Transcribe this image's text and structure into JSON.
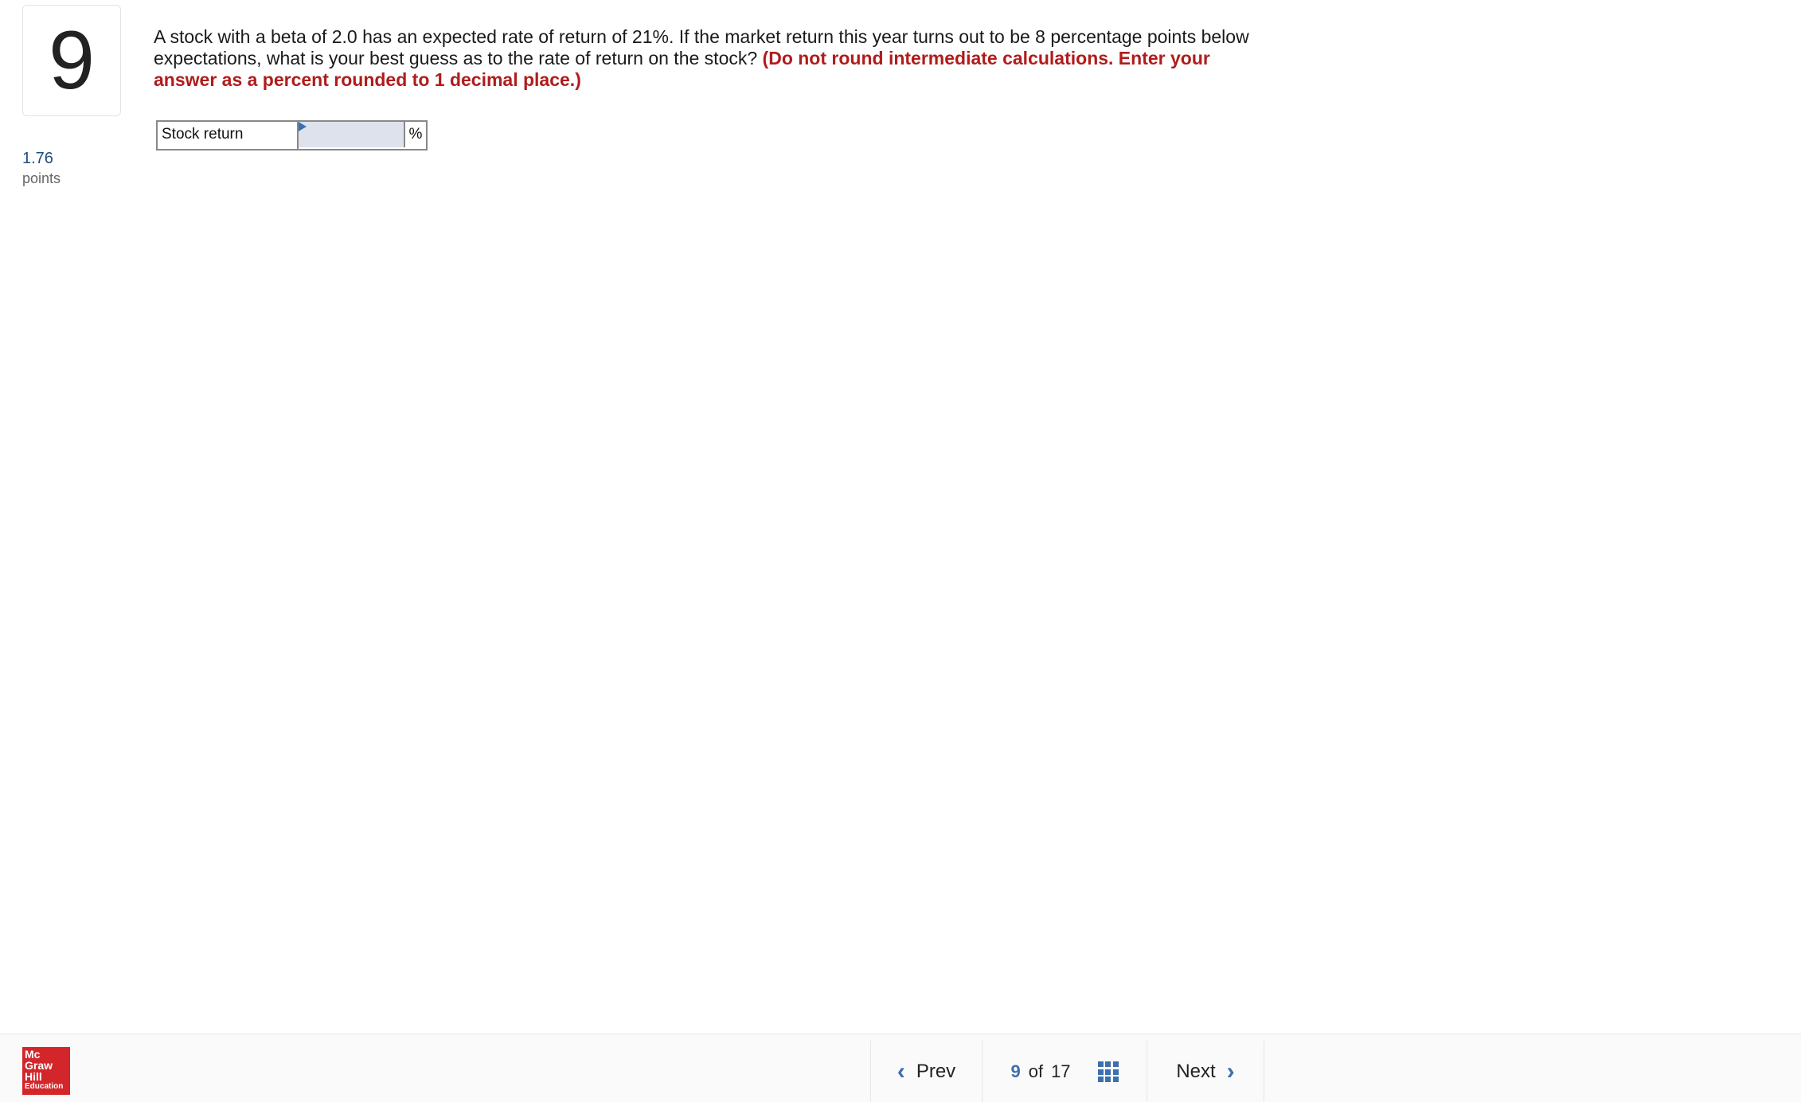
{
  "question": {
    "number": "9",
    "points_value": "1.76",
    "points_label": "points",
    "text": "A stock with a beta of 2.0 has an expected rate of return of 21%. If the market return this year turns out to be 8 percentage points below expectations, what is your best guess as to the rate of return on the stock?",
    "instruction": "(Do not round intermediate calculations. Enter your answer as a percent rounded to 1 decimal place.)"
  },
  "answer": {
    "label": "Stock return",
    "value": "",
    "unit": "%"
  },
  "footer": {
    "logo_lines": [
      "Mc",
      "Graw",
      "Hill",
      "Education"
    ],
    "prev_label": "Prev",
    "current_page": "9",
    "of_word": "of",
    "total_pages": "17",
    "next_label": "Next"
  },
  "colors": {
    "accent": "#3d6fae",
    "instruction_red": "#b01c1c",
    "logo_red": "#d3262a",
    "input_bg": "#dde2ec"
  }
}
